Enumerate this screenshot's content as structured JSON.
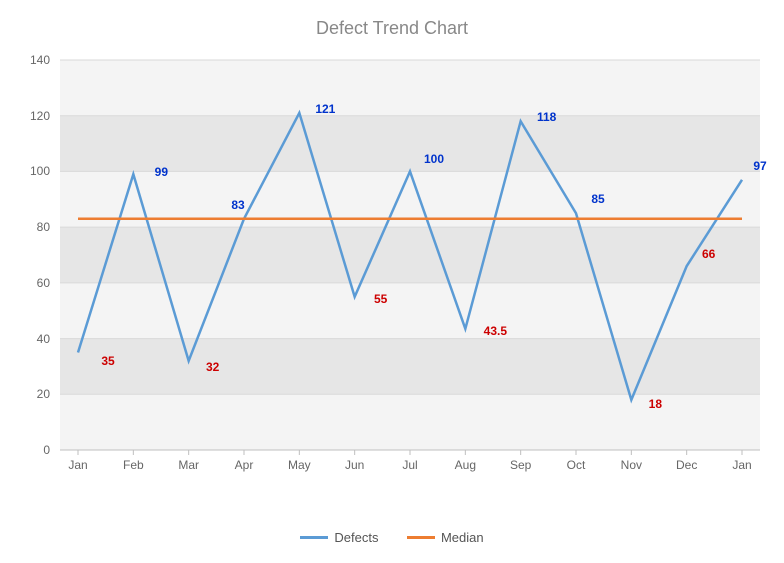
{
  "chart_data": {
    "type": "line",
    "title": "Defect Trend Chart",
    "categories": [
      "Jan",
      "Feb",
      "Mar",
      "Apr",
      "May",
      "Jun",
      "Jul",
      "Aug",
      "Sep",
      "Oct",
      "Nov",
      "Dec",
      "Jan"
    ],
    "series": [
      {
        "name": "Defects",
        "color": "#5B9BD5",
        "values": [
          35,
          99,
          32,
          83,
          121,
          55,
          100,
          43.5,
          118,
          85,
          18,
          66,
          97
        ]
      },
      {
        "name": "Median",
        "color": "#ED7D31",
        "values": [
          83,
          83,
          83,
          83,
          83,
          83,
          83,
          83,
          83,
          83,
          83,
          83,
          83
        ]
      }
    ],
    "ylim": [
      0,
      140
    ],
    "y_ticks": [
      0,
      20,
      40,
      60,
      80,
      100,
      120,
      140
    ],
    "labels": [
      {
        "idx": 0,
        "text": "35",
        "kind": "low",
        "dx": 30,
        "dy": 8
      },
      {
        "idx": 1,
        "text": "99",
        "kind": "high",
        "dx": 28,
        "dy": -2
      },
      {
        "idx": 2,
        "text": "32",
        "kind": "low",
        "dx": 24,
        "dy": 6
      },
      {
        "idx": 3,
        "text": "83",
        "kind": "high",
        "dx": -6,
        "dy": -14
      },
      {
        "idx": 4,
        "text": "121",
        "kind": "high",
        "dx": 26,
        "dy": -4
      },
      {
        "idx": 5,
        "text": "55",
        "kind": "low",
        "dx": 26,
        "dy": 2
      },
      {
        "idx": 6,
        "text": "100",
        "kind": "high",
        "dx": 24,
        "dy": -12
      },
      {
        "idx": 7,
        "text": "43.5",
        "kind": "low",
        "dx": 30,
        "dy": 2
      },
      {
        "idx": 8,
        "text": "118",
        "kind": "high",
        "dx": 26,
        "dy": -4
      },
      {
        "idx": 9,
        "text": "85",
        "kind": "high",
        "dx": 22,
        "dy": -14
      },
      {
        "idx": 10,
        "text": "18",
        "kind": "low",
        "dx": 24,
        "dy": 4
      },
      {
        "idx": 11,
        "text": "66",
        "kind": "low",
        "dx": 22,
        "dy": -12
      },
      {
        "idx": 12,
        "text": "97",
        "kind": "high",
        "dx": 18,
        "dy": -14
      }
    ],
    "legend_labels": {
      "defects": "Defects",
      "median": "Median"
    },
    "colors": {
      "grid_dark": "#e6e6e6",
      "grid_light": "#f4f4f4",
      "axis": "#bfbfbf"
    }
  }
}
